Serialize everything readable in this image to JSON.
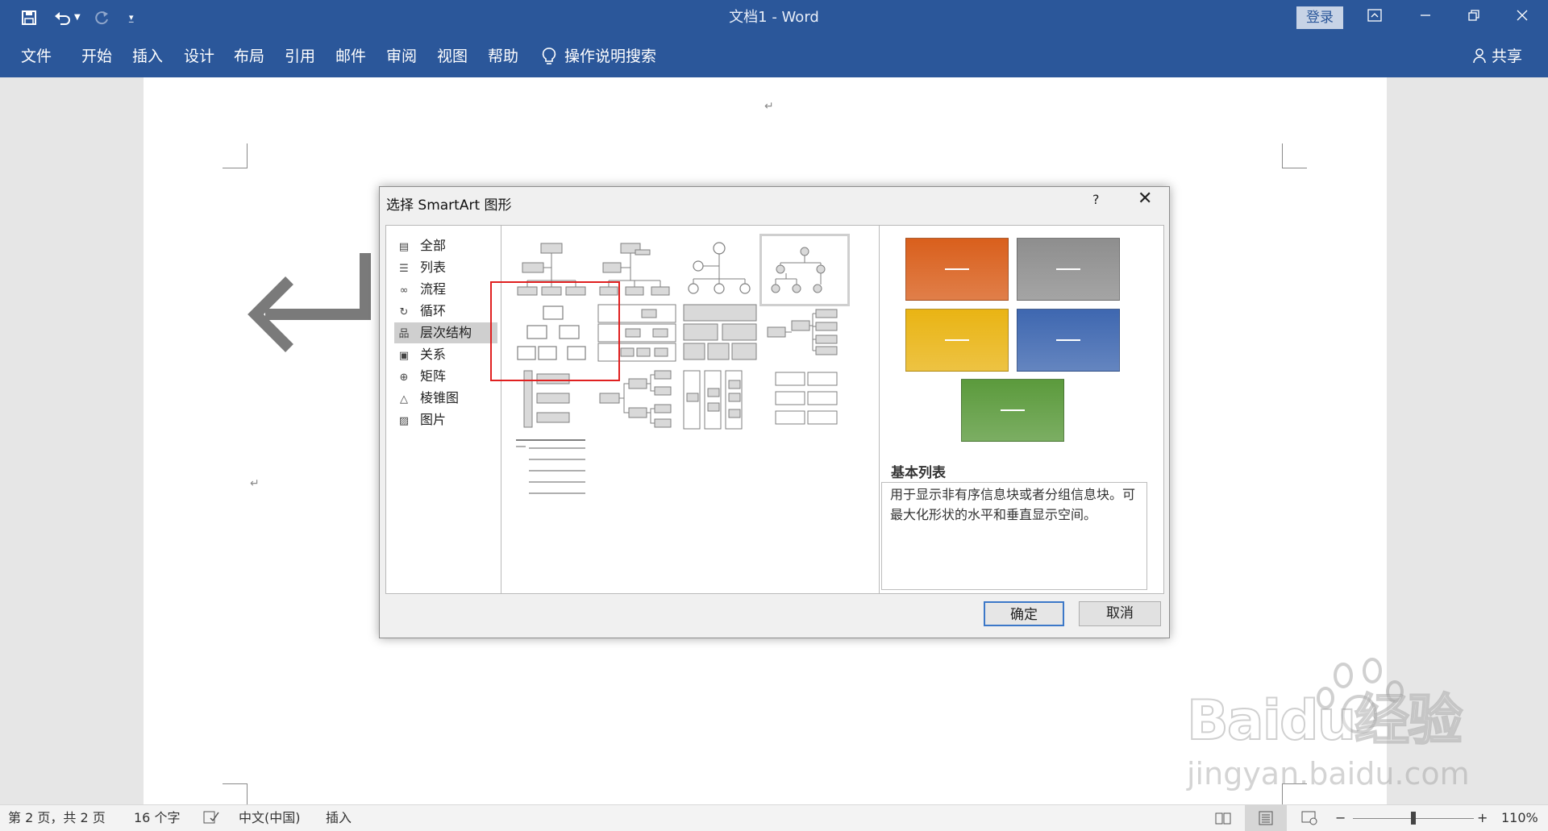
{
  "app": {
    "title": "文档1  -  Word",
    "login_label": "登录"
  },
  "qat": {
    "save_icon": "save-icon",
    "undo_icon": "undo-icon",
    "redo_icon": "redo-icon",
    "customize_icon": "customize-qat-icon"
  },
  "window_controls": {
    "ribbon_display_icon": "ribbon-display-icon",
    "minimize_icon": "minimize-icon",
    "restore_icon": "restore-icon",
    "close_icon": "close-icon"
  },
  "ribbon": {
    "tabs": [
      "文件",
      "开始",
      "插入",
      "设计",
      "布局",
      "引用",
      "邮件",
      "审阅",
      "视图",
      "帮助"
    ],
    "search_label": "操作说明搜索",
    "share_label": "共享"
  },
  "dialog": {
    "title": "选择 SmartArt 图形",
    "help_label": "?",
    "close_label": "✕",
    "categories": [
      {
        "label": "全部",
        "icon": "all-icon"
      },
      {
        "label": "列表",
        "icon": "list-icon"
      },
      {
        "label": "流程",
        "icon": "process-icon"
      },
      {
        "label": "循环",
        "icon": "cycle-icon"
      },
      {
        "label": "层次结构",
        "icon": "hierarchy-icon",
        "selected": true
      },
      {
        "label": "关系",
        "icon": "relationship-icon"
      },
      {
        "label": "矩阵",
        "icon": "matrix-icon"
      },
      {
        "label": "棱锥图",
        "icon": "pyramid-icon"
      },
      {
        "label": "图片",
        "icon": "picture-icon"
      }
    ],
    "preview": {
      "title": "基本列表",
      "description": "用于显示非有序信息块或者分组信息块。可最大化形状的水平和垂直显示空间。",
      "colors": [
        "#d95f1c",
        "#8e8e8e",
        "#e9b414",
        "#3e67b0",
        "#5b9a3c"
      ]
    },
    "ok_label": "确定",
    "cancel_label": "取消"
  },
  "status": {
    "page": "第 2 页，共 2 页",
    "words": "16 个字",
    "language": "中文(中国)",
    "mode": "插入",
    "zoom": "110%",
    "zoom_minus": "−",
    "zoom_plus": "+"
  },
  "watermark": {
    "brand": "Baidu经验",
    "url": "jingyan.baidu.com"
  }
}
